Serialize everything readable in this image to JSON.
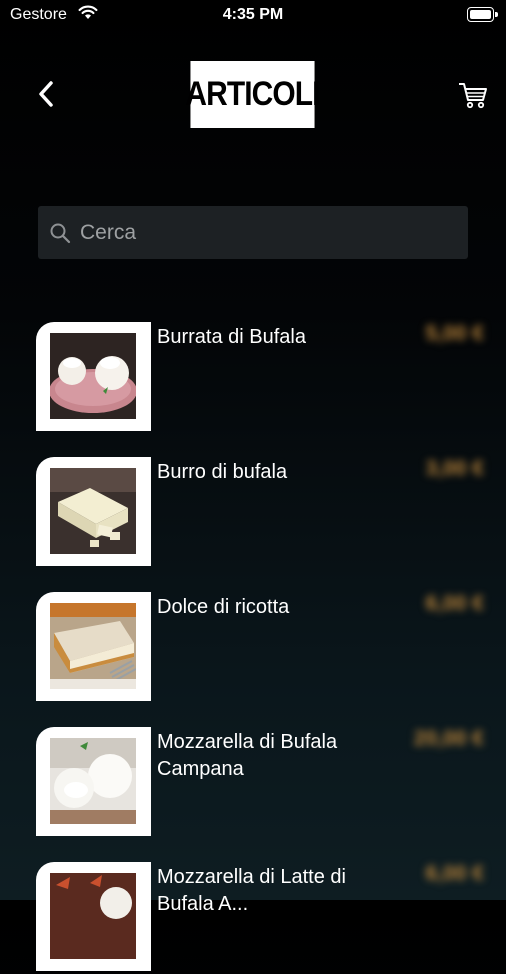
{
  "statusbar": {
    "carrier": "Gestore",
    "time": "4:35 PM"
  },
  "header": {
    "title": "ARTICOLI"
  },
  "search": {
    "placeholder": "Cerca",
    "value": ""
  },
  "products": [
    {
      "name": "Burrata di Bufala",
      "price": "5,00 €"
    },
    {
      "name": "Burro di bufala",
      "price": "3,00 €"
    },
    {
      "name": "Dolce di ricotta",
      "price": "6,00 €"
    },
    {
      "name": "Mozzarella di Bufala Campana",
      "price": "20,00 €"
    },
    {
      "name": "Mozzarella di Latte di Bufala A...",
      "price": "6,00 €"
    }
  ],
  "colors": {
    "price_text": "#b8833a",
    "search_bg": "#1d2124",
    "accent_white": "#ffffff"
  }
}
